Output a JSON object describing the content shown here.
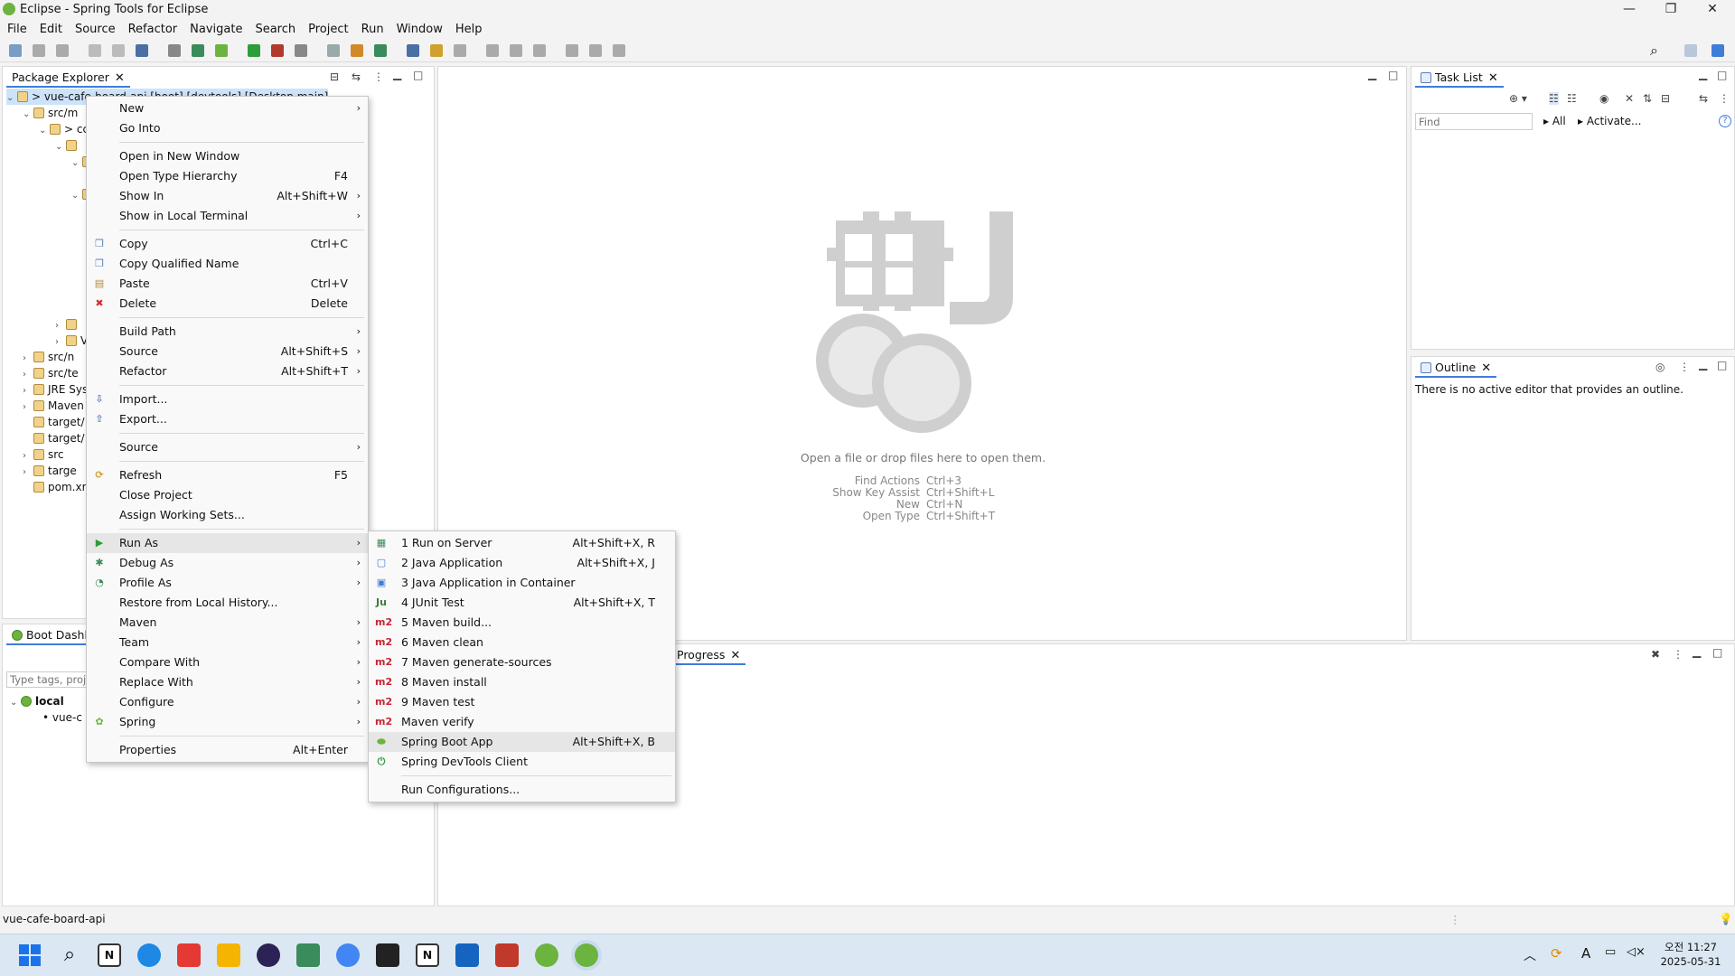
{
  "window": {
    "title": "Eclipse - Spring Tools for Eclipse",
    "minimize": "—",
    "maximize": "❐",
    "close": "✕"
  },
  "menubar": [
    "File",
    "Edit",
    "Source",
    "Refactor",
    "Navigate",
    "Search",
    "Project",
    "Run",
    "Window",
    "Help"
  ],
  "package_explorer": {
    "tab": "Package Explorer",
    "tree": [
      {
        "label": "> vue-cafe-board-api [boot] [devtools] [Desktop main]",
        "indent": 0,
        "arrow": "⌄",
        "selected": true
      },
      {
        "label": "src/m",
        "indent": 1,
        "arrow": "⌄"
      },
      {
        "label": "> cc",
        "indent": 2,
        "arrow": "⌄"
      },
      {
        "label": "",
        "indent": 3,
        "arrow": "⌄"
      },
      {
        "label": "",
        "indent": 4,
        "arrow": "⌄"
      },
      {
        "label": "",
        "indent": 5,
        "arrow": "›"
      },
      {
        "label": "",
        "indent": 4,
        "arrow": "⌄"
      },
      {
        "label": "",
        "indent": 5,
        "arrow": "›"
      },
      {
        "label": "",
        "indent": 5,
        "arrow": "⌄"
      },
      {
        "label": "",
        "indent": 6,
        "arrow": ""
      },
      {
        "label": "",
        "indent": 6,
        "arrow": ""
      },
      {
        "label": "",
        "indent": 5,
        "arrow": "›"
      },
      {
        "label": "",
        "indent": 5,
        "arrow": "›"
      },
      {
        "label": "",
        "indent": 5,
        "arrow": "›"
      },
      {
        "label": "",
        "indent": 3,
        "arrow": "›"
      },
      {
        "label": "V",
        "indent": 3,
        "arrow": "›"
      },
      {
        "label": "src/n",
        "indent": 1,
        "arrow": "›"
      },
      {
        "label": "src/te",
        "indent": 1,
        "arrow": "›"
      },
      {
        "label": "JRE Sys",
        "indent": 1,
        "arrow": "›"
      },
      {
        "label": "Maven",
        "indent": 1,
        "arrow": "›"
      },
      {
        "label": "target/",
        "indent": 1,
        "arrow": ""
      },
      {
        "label": "target/",
        "indent": 1,
        "arrow": ""
      },
      {
        "label": "src",
        "indent": 1,
        "arrow": "›"
      },
      {
        "label": "targe",
        "indent": 1,
        "arrow": "›"
      },
      {
        "label": "pom.xr",
        "indent": 1,
        "arrow": ""
      }
    ]
  },
  "boot_dashboard": {
    "tab": "Boot Dashbo",
    "filter_placeholder": "Type tags, proje",
    "local": "local",
    "app": "vue-c"
  },
  "editor": {
    "drop_hint": "Open a file or drop files here to open them.",
    "hints": [
      {
        "action": "Find Actions",
        "key": "Ctrl+3"
      },
      {
        "action": "Show Key Assist",
        "key": "Ctrl+Shift+L"
      },
      {
        "action": "New",
        "key": "Ctrl+N"
      },
      {
        "action": "Open Type",
        "key": "Ctrl+Shift+T"
      }
    ]
  },
  "task_list": {
    "tab": "Task List",
    "find_placeholder": "Find",
    "all": "All",
    "activate": "Activate..."
  },
  "outline": {
    "tab": "Outline",
    "message": "There is no active editor that provides an outline."
  },
  "progress": {
    "tab": "Progress"
  },
  "status_bar": {
    "text": "vue-cafe-board-api"
  },
  "context_menu": {
    "items": [
      {
        "label": "New",
        "sub": true
      },
      {
        "label": "Go Into"
      },
      {
        "sep": true
      },
      {
        "label": "Open in New Window"
      },
      {
        "label": "Open Type Hierarchy",
        "shortcut": "F4"
      },
      {
        "label": "Show In",
        "shortcut": "Alt+Shift+W",
        "sub": true
      },
      {
        "label": "Show in Local Terminal",
        "sub": true
      },
      {
        "sep": true
      },
      {
        "label": "Copy",
        "shortcut": "Ctrl+C",
        "icon": "copy-icon"
      },
      {
        "label": "Copy Qualified Name",
        "icon": "copy-qualified-icon"
      },
      {
        "label": "Paste",
        "shortcut": "Ctrl+V",
        "icon": "paste-icon"
      },
      {
        "label": "Delete",
        "shortcut": "Delete",
        "icon": "delete-icon"
      },
      {
        "sep": true
      },
      {
        "label": "Build Path",
        "sub": true
      },
      {
        "label": "Source",
        "shortcut": "Alt+Shift+S",
        "sub": true
      },
      {
        "label": "Refactor",
        "shortcut": "Alt+Shift+T",
        "sub": true
      },
      {
        "sep": true
      },
      {
        "label": "Import...",
        "icon": "import-icon"
      },
      {
        "label": "Export...",
        "icon": "export-icon"
      },
      {
        "sep": true
      },
      {
        "label": "Source",
        "sub": true
      },
      {
        "sep": true
      },
      {
        "label": "Refresh",
        "shortcut": "F5",
        "icon": "refresh-icon"
      },
      {
        "label": "Close Project"
      },
      {
        "label": "Assign Working Sets..."
      },
      {
        "sep": true
      },
      {
        "label": "Run As",
        "sub": true,
        "icon": "run-icon",
        "highlight": true
      },
      {
        "label": "Debug As",
        "sub": true,
        "icon": "debug-icon"
      },
      {
        "label": "Profile As",
        "sub": true,
        "icon": "profile-icon"
      },
      {
        "label": "Restore from Local History..."
      },
      {
        "label": "Maven",
        "sub": true
      },
      {
        "label": "Team",
        "sub": true
      },
      {
        "label": "Compare With",
        "sub": true
      },
      {
        "label": "Replace With",
        "sub": true
      },
      {
        "label": "Configure",
        "sub": true
      },
      {
        "label": "Spring",
        "sub": true,
        "icon": "spring-icon"
      },
      {
        "sep": true
      },
      {
        "label": "Properties",
        "shortcut": "Alt+Enter"
      }
    ]
  },
  "run_as_menu": {
    "items": [
      {
        "label": "1 Run on Server",
        "shortcut": "Alt+Shift+X, R",
        "icon": "server-icon"
      },
      {
        "label": "2 Java Application",
        "shortcut": "Alt+Shift+X, J",
        "icon": "java-app-icon"
      },
      {
        "label": "3 Java Application in Container",
        "icon": "container-icon"
      },
      {
        "label": "4 JUnit Test",
        "shortcut": "Alt+Shift+X, T",
        "icon": "junit-icon",
        "glyph": "Ju"
      },
      {
        "label": "5 Maven build...",
        "icon": "maven-icon",
        "glyph": "m2"
      },
      {
        "label": "6 Maven clean",
        "icon": "maven-icon",
        "glyph": "m2"
      },
      {
        "label": "7 Maven generate-sources",
        "icon": "maven-icon",
        "glyph": "m2"
      },
      {
        "label": "8 Maven install",
        "icon": "maven-icon",
        "glyph": "m2"
      },
      {
        "label": "9 Maven test",
        "icon": "maven-icon",
        "glyph": "m2"
      },
      {
        "label": "Maven verify",
        "icon": "maven-icon",
        "glyph": "m2"
      },
      {
        "label": "Spring Boot App",
        "shortcut": "Alt+Shift+X, B",
        "icon": "spring-boot-icon",
        "highlight": true
      },
      {
        "label": "Spring DevTools Client",
        "icon": "devtools-icon"
      },
      {
        "sep": true
      },
      {
        "label": "Run Configurations..."
      }
    ]
  },
  "taskbar": {
    "time": "오전 11:27",
    "date": "2025-05-31"
  },
  "colors": {
    "accent": "#3f7dd8",
    "spring": "#6db33f",
    "maven": "#c82333"
  }
}
